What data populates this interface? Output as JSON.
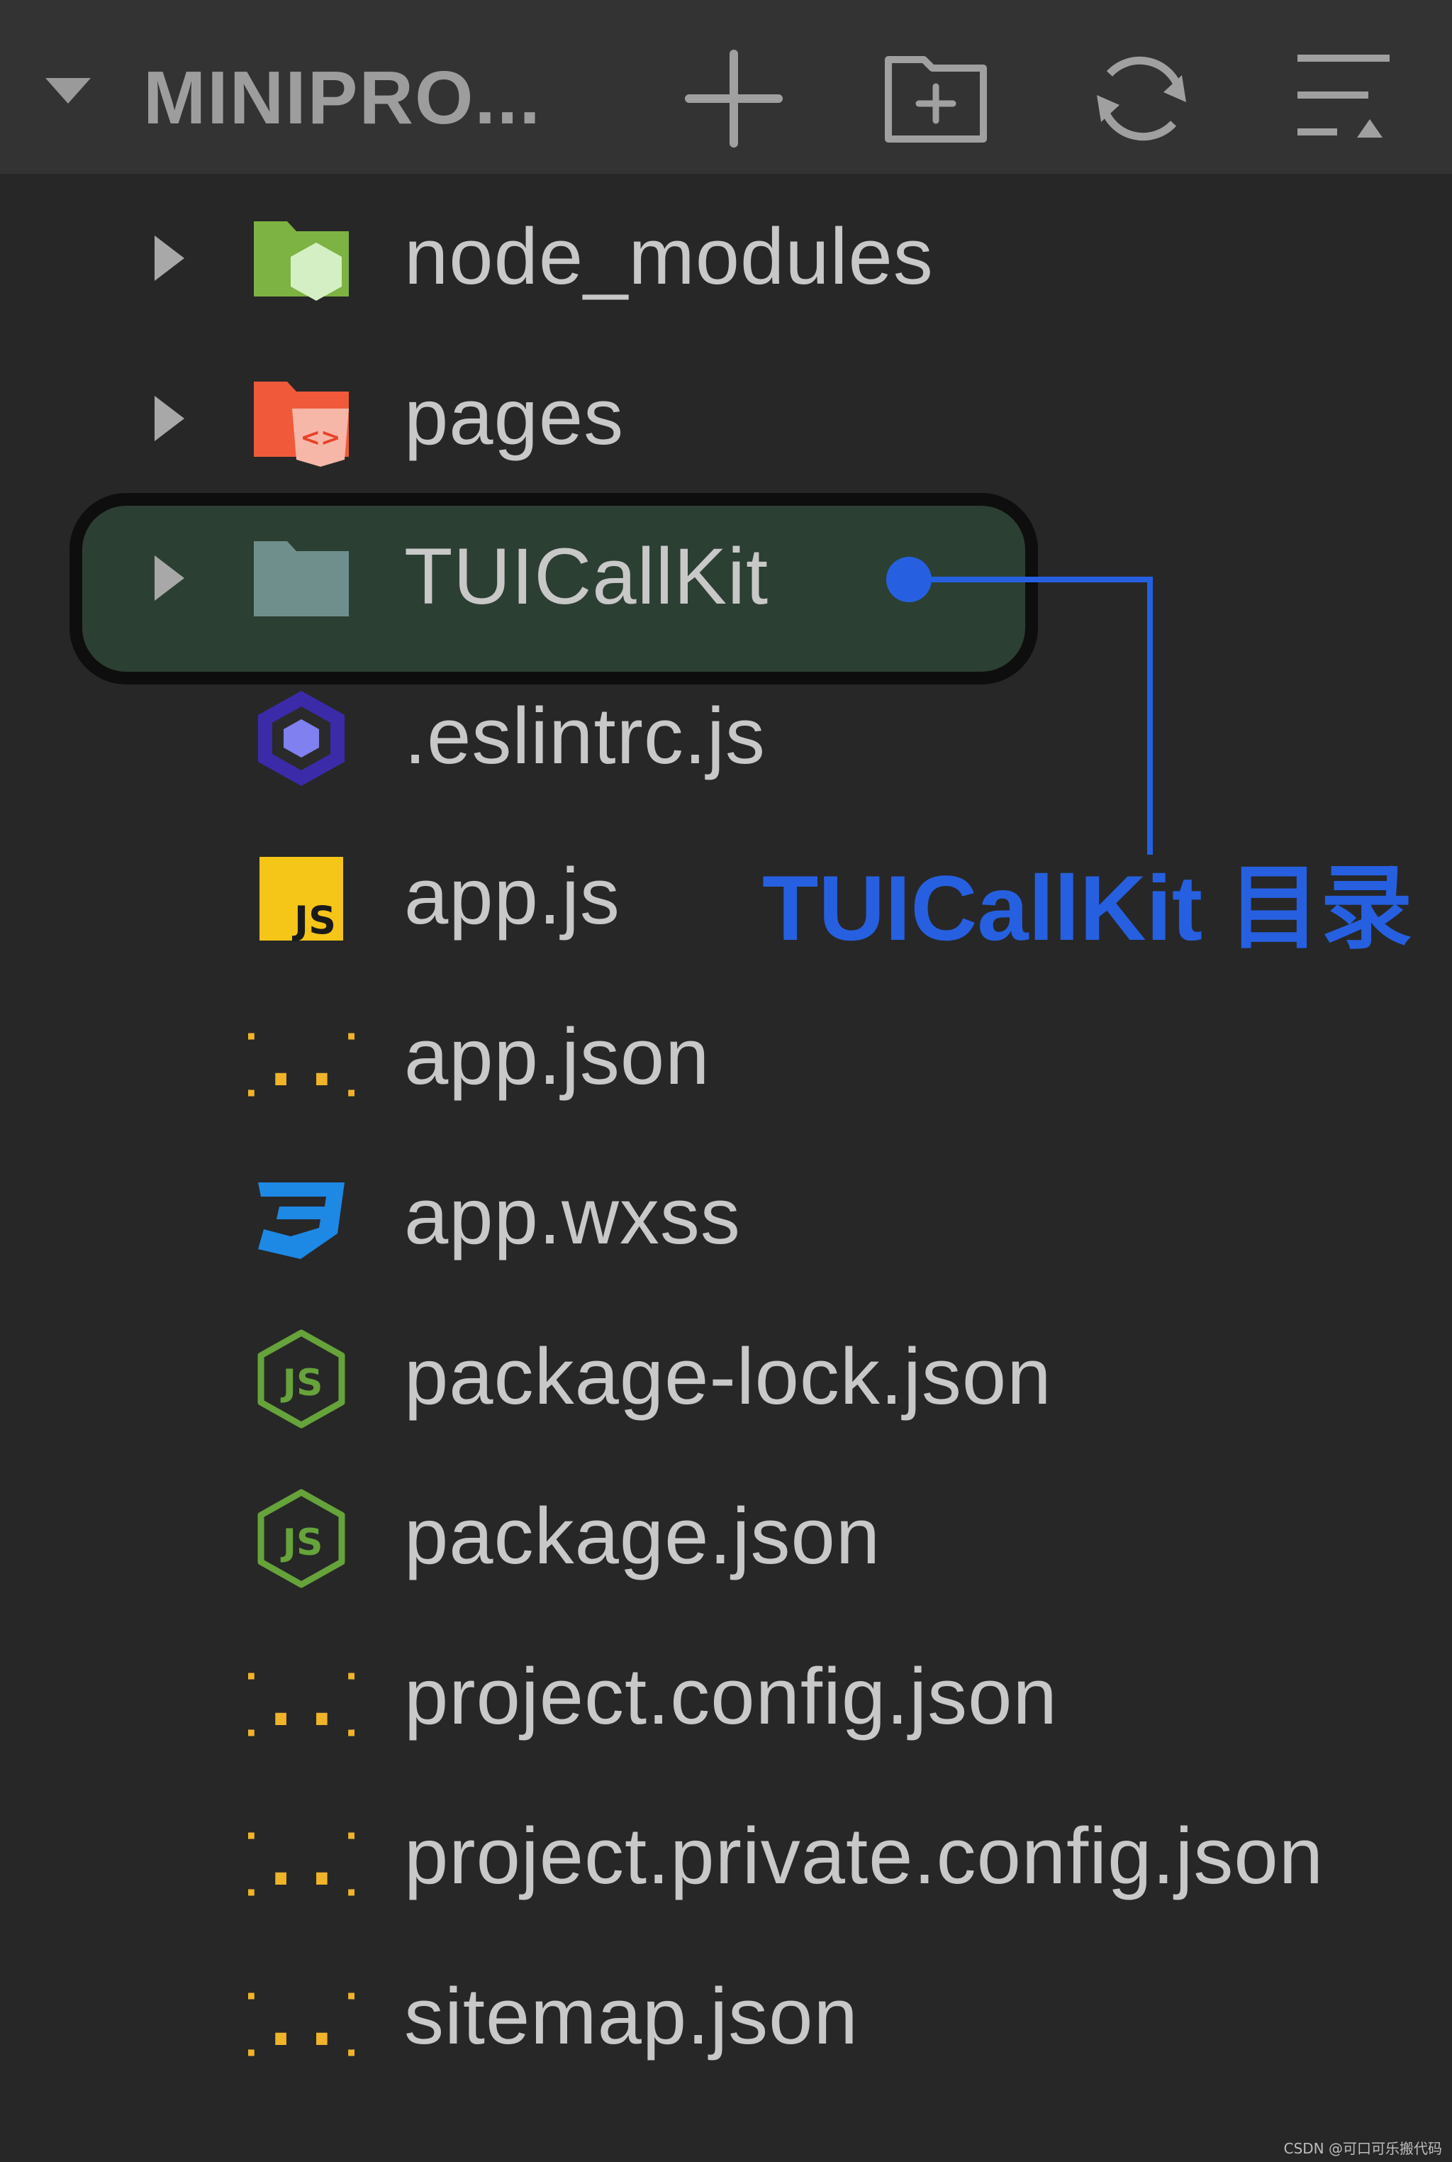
{
  "explorer": {
    "title": "MINIPRO...",
    "header_icons": [
      "chevron-down-icon",
      "new-file-icon",
      "new-folder-icon",
      "refresh-icon",
      "collapse-all-icon"
    ]
  },
  "tree": {
    "folders": [
      {
        "name": "node_modules",
        "icon": "node-modules-folder-icon",
        "color": "#7cb342"
      },
      {
        "name": "pages",
        "icon": "pages-folder-icon",
        "color": "#f05a3a"
      },
      {
        "name": "TUICallKit",
        "icon": "folder-icon",
        "color": "#6f8f8c"
      }
    ],
    "files": [
      {
        "name": ".eslintrc.js",
        "icon": "eslint-icon",
        "color": "#4b32c3"
      },
      {
        "name": "app.js",
        "icon": "js-icon",
        "color": "#f5c518"
      },
      {
        "name": "app.json",
        "icon": "json-icon",
        "color": "#f0b429"
      },
      {
        "name": "app.wxss",
        "icon": "css-icon",
        "color": "#1e88e5"
      },
      {
        "name": "package-lock.json",
        "icon": "nodejs-icon",
        "color": "#66a33a"
      },
      {
        "name": "package.json",
        "icon": "nodejs-icon",
        "color": "#66a33a"
      },
      {
        "name": "project.config.json",
        "icon": "json-icon",
        "color": "#f0b429"
      },
      {
        "name": "project.private.config.json",
        "icon": "json-icon",
        "color": "#f0b429"
      },
      {
        "name": "sitemap.json",
        "icon": "json-icon",
        "color": "#f0b429"
      }
    ]
  },
  "annotation": {
    "label": "TUICallKit 目录",
    "color": "#2660e0"
  },
  "watermark": "CSDN @可口可乐搬代码"
}
